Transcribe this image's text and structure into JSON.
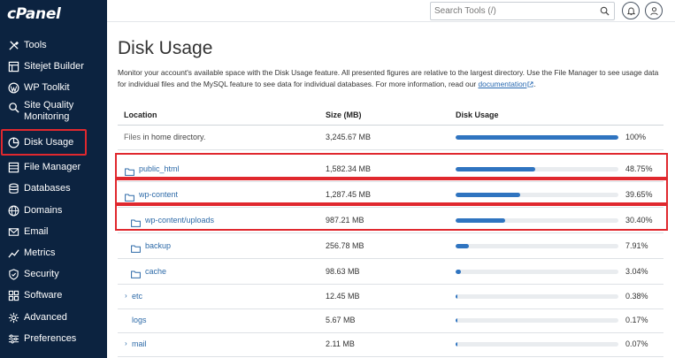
{
  "app": {
    "logo": "cPanel"
  },
  "sidebar": {
    "items": [
      {
        "label": "Tools",
        "icon": "tools-icon"
      },
      {
        "label": "Sitejet Builder",
        "icon": "sitejet-icon"
      },
      {
        "label": "WP Toolkit",
        "icon": "wordpress-icon"
      },
      {
        "label": "Site Quality Monitoring",
        "icon": "search-quality-icon"
      },
      {
        "label": "Disk Usage",
        "icon": "pie-chart-icon"
      },
      {
        "label": "File Manager",
        "icon": "file-manager-icon"
      },
      {
        "label": "Databases",
        "icon": "database-icon"
      },
      {
        "label": "Domains",
        "icon": "globe-icon"
      },
      {
        "label": "Email",
        "icon": "envelope-icon"
      },
      {
        "label": "Metrics",
        "icon": "metrics-icon"
      },
      {
        "label": "Security",
        "icon": "shield-icon"
      },
      {
        "label": "Software",
        "icon": "software-icon"
      },
      {
        "label": "Advanced",
        "icon": "advanced-icon"
      },
      {
        "label": "Preferences",
        "icon": "preferences-icon"
      }
    ],
    "active": "Disk Usage"
  },
  "topbar": {
    "search_placeholder": "Search Tools (/)"
  },
  "main": {
    "title": "Disk Usage",
    "description_part1": "Monitor your account's available space with the Disk Usage feature. All presented figures are relative to the largest directory. Use the File Manager to see usage data for individual files and the MySQL feature to see data for individual databases. For more information, read our ",
    "doc_link": "documentation",
    "description_part2": ".",
    "columns": {
      "location": "Location",
      "size": "Size (MB)",
      "usage": "Disk Usage"
    },
    "rows": [
      {
        "prefix": "Files",
        "name": " in home directory.",
        "size": "3,245.67 MB",
        "percent": "100%",
        "fraction": 1.0,
        "kind": "files"
      },
      {
        "name": "public_html",
        "size": "1,582.34 MB",
        "percent": "48.75%",
        "fraction": 0.4875,
        "kind": "folder"
      },
      {
        "name": "wp-content",
        "size": "1,287.45 MB",
        "percent": "39.65%",
        "fraction": 0.3965,
        "kind": "folder"
      },
      {
        "name": "wp-content/uploads",
        "size": "987.21 MB",
        "percent": "30.40%",
        "fraction": 0.304,
        "kind": "folder-sub"
      },
      {
        "name": "backup",
        "size": "256.78 MB",
        "percent": "7.91%",
        "fraction": 0.0791,
        "kind": "folder-sub"
      },
      {
        "name": "cache",
        "size": "98.63 MB",
        "percent": "3.04%",
        "fraction": 0.0304,
        "kind": "folder-sub"
      },
      {
        "name": "etc",
        "size": "12.45 MB",
        "percent": "0.38%",
        "fraction": 0.0038,
        "kind": "caret"
      },
      {
        "name": "logs",
        "size": "5.67 MB",
        "percent": "0.17%",
        "fraction": 0.0017,
        "kind": "plain"
      },
      {
        "name": "mail",
        "size": "2.11 MB",
        "percent": "0.07%",
        "fraction": 0.0007,
        "kind": "caret"
      }
    ]
  },
  "colors": {
    "sidebar": "#0c2340",
    "accent": "#2f74c0",
    "highlight": "#e0282e",
    "link": "#2d6aa8"
  }
}
